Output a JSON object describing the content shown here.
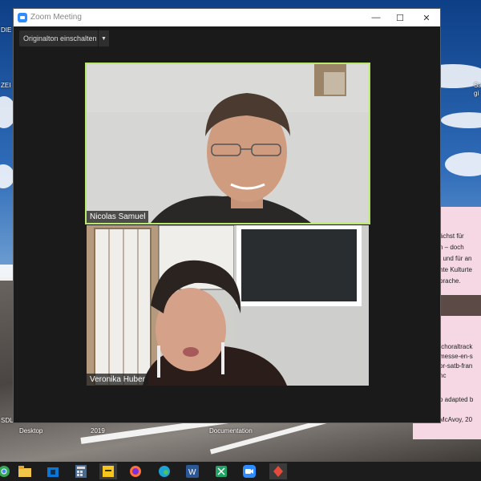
{
  "desktop": {
    "icon_labels": [
      "ZEI",
      "SDL",
      "DIE",
      "Desktop",
      "2019",
      "Documentation"
    ],
    "right_text": [
      "Sa",
      "gi"
    ]
  },
  "note_window": {
    "lines": [
      "ächst für",
      "n – doch",
      "t und für an",
      "hte Kulturte",
      "prache.",
      "/choraltrack",
      "messe-en-s",
      "or-satb-fran",
      "nc",
      "o adapted b",
      "McAvoy, 20"
    ]
  },
  "zoom": {
    "title": "Zoom Meeting",
    "original_audio_label": "Originalton einschalten",
    "participants": [
      {
        "name": "Nicolas Samuel",
        "active_speaker": true
      },
      {
        "name": "Veronika Huber",
        "active_speaker": false
      }
    ],
    "active_speaker_color": "#b9e86c"
  },
  "taskbar": {
    "apps": [
      "chrome-icon",
      "file-explorer-icon",
      "store-icon",
      "calculator-icon",
      "sticky-notes-icon",
      "firefox-icon",
      "edge-icon",
      "word-icon",
      "sheets-icon",
      "zoom-icon",
      "app-icon"
    ]
  }
}
